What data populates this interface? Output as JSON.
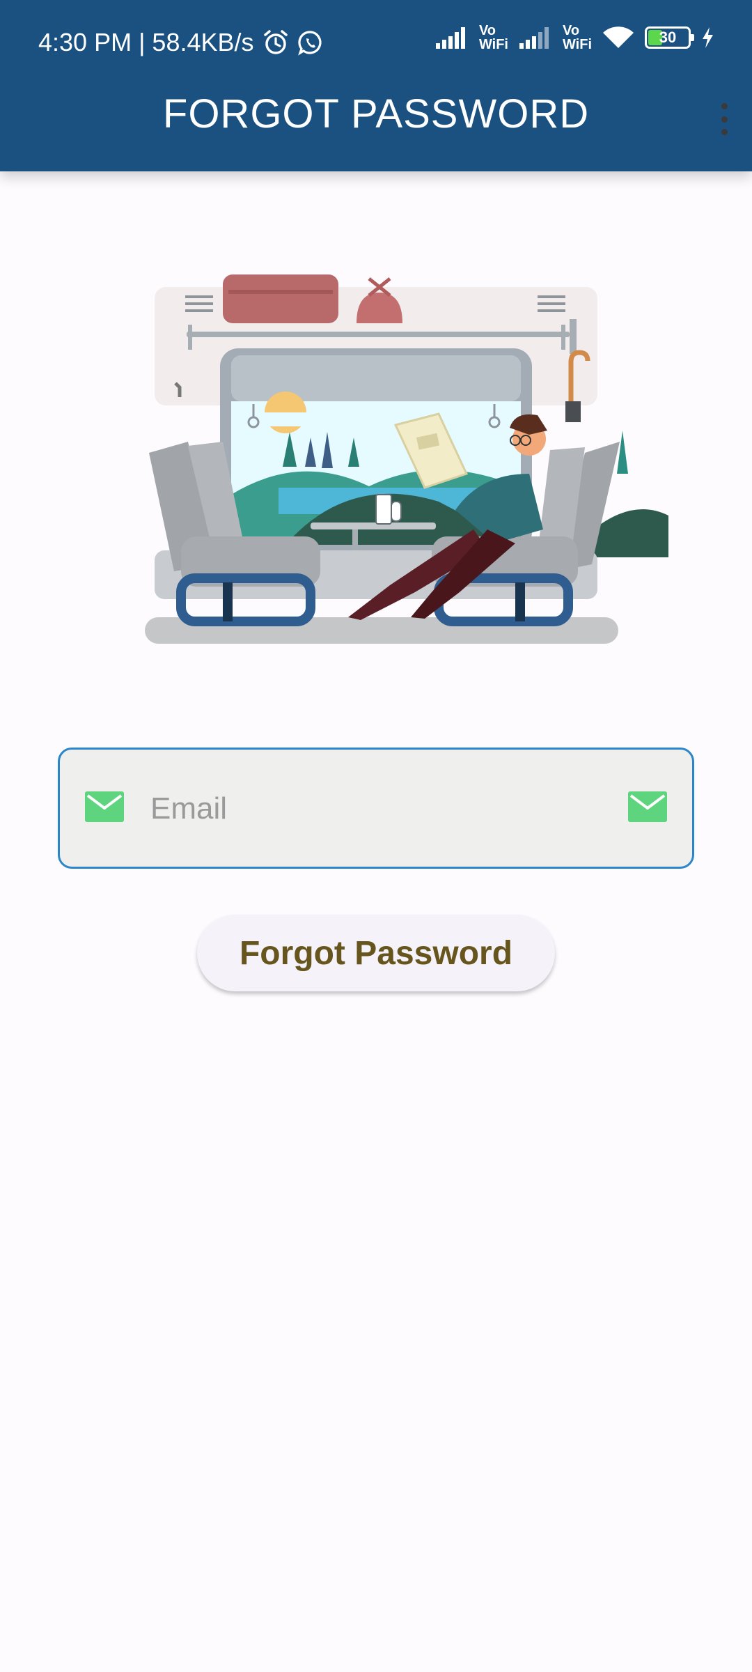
{
  "status_bar": {
    "time_speed": "4:30 PM | 58.4KB/s",
    "battery_level": "30",
    "sim1_label_top": "Vo",
    "sim1_label_bottom": "WiFi",
    "sim2_label_top": "Vo",
    "sim2_label_bottom": "WiFi"
  },
  "app_bar": {
    "title": "FORGOT PASSWORD"
  },
  "form": {
    "email_placeholder": "Email",
    "email_value": "",
    "submit_label": "Forgot Password"
  },
  "colors": {
    "app_bar": "#1a5180",
    "input_border": "#2a86c9",
    "mail_icon": "#5ed47f",
    "button_text": "#66561e"
  },
  "icons": {
    "alarm": "alarm-icon",
    "whatsapp": "whatsapp-icon",
    "signal": "signal-icon",
    "wifi": "wifi-icon",
    "battery": "battery-icon",
    "charging": "charging-bolt-icon",
    "mail": "mail-icon",
    "menu": "more-vert-icon"
  }
}
